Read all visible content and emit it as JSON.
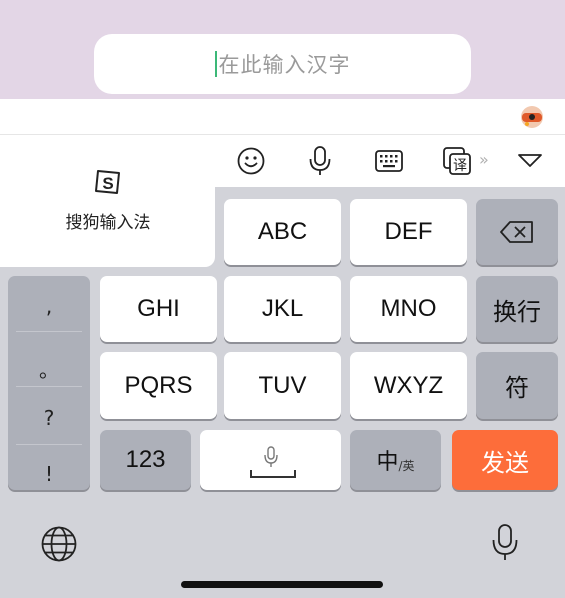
{
  "input": {
    "placeholder": "在此输入汉字"
  },
  "branding": {
    "name": "搜狗输入法"
  },
  "toolbar": {
    "icons": [
      "smiley-icon",
      "microphone-icon",
      "keyboard-icon",
      "translate-icon",
      "more-arrows-icon",
      "collapse-triangle-icon"
    ],
    "more": "»",
    "translate_glyph": "译"
  },
  "keys": {
    "row1": [
      "ABC",
      "DEF"
    ],
    "row2": [
      "GHI",
      "JKL",
      "MNO"
    ],
    "row3": [
      "PQRS",
      "TUV",
      "WXYZ"
    ],
    "switch_123": "123",
    "lang_main": "中",
    "lang_sub": "/英",
    "send": "发送",
    "enter": "换行",
    "symbols": "符"
  },
  "punctuation": [
    ",",
    "。",
    "?",
    "!"
  ],
  "colors": {
    "accent_send": "#fd6d3a",
    "cursor": "#3cb878",
    "top_background": "#e3d6e6"
  }
}
